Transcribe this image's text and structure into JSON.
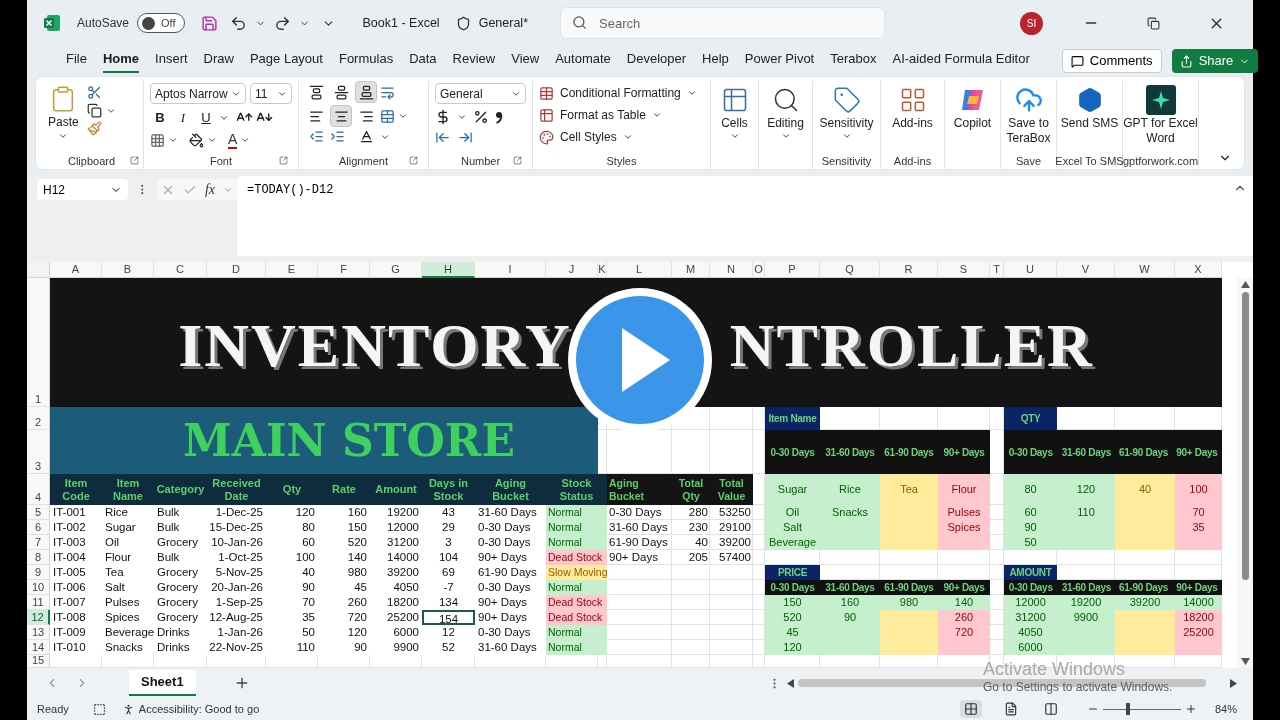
{
  "title_bar": {
    "autosave_label": "AutoSave",
    "autosave": {
      "on": false,
      "text": "Off"
    },
    "title": "Book1 - Excel",
    "sensitivity": "General*",
    "search_placeholder": "Search",
    "user_initials": "SI"
  },
  "menu_tabs": [
    {
      "label": "File",
      "selected": false
    },
    {
      "label": "Home",
      "selected": true
    },
    {
      "label": "Insert",
      "selected": false
    },
    {
      "label": "Draw",
      "selected": false
    },
    {
      "label": "Page Layout",
      "selected": false
    },
    {
      "label": "Formulas",
      "selected": false
    },
    {
      "label": "Data",
      "selected": false
    },
    {
      "label": "Review",
      "selected": false
    },
    {
      "label": "View",
      "selected": false
    },
    {
      "label": "Automate",
      "selected": false
    },
    {
      "label": "Developer",
      "selected": false
    },
    {
      "label": "Help",
      "selected": false
    },
    {
      "label": "Power Pivot",
      "selected": false
    },
    {
      "label": "Terabox",
      "selected": false
    },
    {
      "label": "AI-aided Formula Editor",
      "selected": false
    }
  ],
  "comments_button": "Comments",
  "share_button": "Share",
  "ribbon": {
    "clipboard": {
      "paste": "Paste",
      "label": "Clipboard"
    },
    "font": {
      "family": "Aptos Narrow",
      "size": "11",
      "bold": "B",
      "italic": "I",
      "underline": "U",
      "color_letter": "A",
      "label": "Font"
    },
    "alignment": {
      "vertical": [
        {
          "selected": false
        },
        {
          "selected": false
        },
        {
          "selected": true
        }
      ],
      "horizontal": [
        {
          "selected": false
        },
        {
          "selected": true
        },
        {
          "selected": false
        }
      ],
      "label": "Alignment"
    },
    "number": {
      "format": "General",
      "label": "Number"
    },
    "styles": {
      "items": [
        "Conditional Formatting",
        "Format as Table",
        "Cell Styles"
      ],
      "label": "Styles"
    },
    "large": [
      {
        "kind": "cells",
        "label": "Cells",
        "dropdown": true
      },
      {
        "kind": "editing",
        "label": "Editing",
        "dropdown": true
      },
      {
        "kind": "sensitivity",
        "label": "Sensitivity",
        "dropdown": true,
        "group": "Sensitivity"
      },
      {
        "kind": "addins",
        "label": "Add-ins",
        "dropdown": false,
        "group": "Add-ins"
      },
      {
        "kind": "copilot",
        "label": "Copilot",
        "dropdown": false
      },
      {
        "kind": "terabox",
        "label": "Save to TeraBox",
        "dropdown": false,
        "group": "Save"
      },
      {
        "kind": "sms",
        "label": "Send SMS",
        "dropdown": false,
        "group": "Excel To SMS"
      },
      {
        "kind": "gpt",
        "label": "GPT for Excel Word",
        "dropdown": false,
        "group": "gptforwork.com"
      }
    ]
  },
  "formula_bar": {
    "name_box": "H12",
    "fx": "fx",
    "formula": "=TODAY()-D12"
  },
  "sheet": {
    "columns": [
      {
        "label": "A",
        "selected": false
      },
      {
        "label": "B",
        "selected": false
      },
      {
        "label": "C",
        "selected": false
      },
      {
        "label": "D",
        "selected": false
      },
      {
        "label": "E",
        "selected": false
      },
      {
        "label": "F",
        "selected": false
      },
      {
        "label": "G",
        "selected": false
      },
      {
        "label": "H",
        "selected": true
      },
      {
        "label": "I",
        "selected": false
      },
      {
        "label": "J",
        "selected": false
      },
      {
        "label": "K",
        "selected": false
      },
      {
        "label": "L",
        "selected": false
      },
      {
        "label": "M",
        "selected": false
      },
      {
        "label": "N",
        "selected": false
      },
      {
        "label": "O",
        "selected": false
      },
      {
        "label": "P",
        "selected": false
      },
      {
        "label": "Q",
        "selected": false
      },
      {
        "label": "R",
        "selected": false
      },
      {
        "label": "S",
        "selected": false
      },
      {
        "label": "T",
        "selected": false
      },
      {
        "label": "U",
        "selected": false
      },
      {
        "label": "V",
        "selected": false
      },
      {
        "label": "W",
        "selected": false
      },
      {
        "label": "X",
        "selected": false
      }
    ],
    "rows": [
      {
        "label": "1",
        "selected": false
      },
      {
        "label": "2",
        "selected": false
      },
      {
        "label": "3",
        "selected": false
      },
      {
        "label": "4",
        "selected": false
      },
      {
        "label": "5",
        "selected": false
      },
      {
        "label": "6",
        "selected": false
      },
      {
        "label": "7",
        "selected": false
      },
      {
        "label": "8",
        "selected": false
      },
      {
        "label": "9",
        "selected": false
      },
      {
        "label": "10",
        "selected": false
      },
      {
        "label": "11",
        "selected": false
      },
      {
        "label": "12",
        "selected": true
      },
      {
        "label": "13",
        "selected": false
      },
      {
        "label": "14",
        "selected": false
      },
      {
        "label": "15",
        "selected": false
      }
    ],
    "banner_left": "INVENTORY",
    "banner_right": "NTROLLER",
    "store_title": "MAIN STORE",
    "headers": [
      "Item Code",
      "Item Name",
      "Category",
      "Received Date",
      "Qty",
      "Rate",
      "Amount",
      "Days in Stock",
      "Aging Bucket",
      "Stock Status"
    ],
    "items": [
      {
        "cells": [
          "IT-001",
          "Rice",
          "Bulk",
          "1-Dec-25",
          "120",
          "160",
          "19200",
          "43",
          "31-60 Days"
        ],
        "status": "Normal",
        "kind": "normal",
        "days_selected": false
      },
      {
        "cells": [
          "IT-002",
          "Sugar",
          "Bulk",
          "15-Dec-25",
          "80",
          "150",
          "12000",
          "29",
          "0-30 Days"
        ],
        "status": "Normal",
        "kind": "normal",
        "days_selected": false
      },
      {
        "cells": [
          "IT-003",
          "Oil",
          "Grocery",
          "10-Jan-26",
          "60",
          "520",
          "31200",
          "3",
          "0-30 Days"
        ],
        "status": "Normal",
        "kind": "normal",
        "days_selected": false
      },
      {
        "cells": [
          "IT-004",
          "Flour",
          "Bulk",
          "1-Oct-25",
          "100",
          "140",
          "14000",
          "104",
          "90+ Days"
        ],
        "status": "Dead Stock",
        "kind": "dead",
        "days_selected": false
      },
      {
        "cells": [
          "IT-005",
          "Tea",
          "Grocery",
          "5-Nov-25",
          "40",
          "980",
          "39200",
          "69",
          "61-90 Days"
        ],
        "status": "Slow Moving",
        "kind": "slow",
        "days_selected": false
      },
      {
        "cells": [
          "IT-006",
          "Salt",
          "Grocery",
          "20-Jan-26",
          "90",
          "45",
          "4050",
          "-7",
          "0-30 Days"
        ],
        "status": "Normal",
        "kind": "normal",
        "days_selected": false
      },
      {
        "cells": [
          "IT-007",
          "Pulses",
          "Grocery",
          "1-Sep-25",
          "70",
          "260",
          "18200",
          "134",
          "90+ Days"
        ],
        "status": "Dead Stock",
        "kind": "dead",
        "days_selected": false
      },
      {
        "cells": [
          "IT-008",
          "Spices",
          "Grocery",
          "12-Aug-25",
          "35",
          "720",
          "25200",
          "154",
          "90+ Days"
        ],
        "status": "Dead Stock",
        "kind": "dead",
        "days_selected": true
      },
      {
        "cells": [
          "IT-009",
          "Beverage",
          "Drinks",
          "1-Jan-26",
          "50",
          "120",
          "6000",
          "12",
          "0-30 Days"
        ],
        "status": "Normal",
        "kind": "normal",
        "days_selected": false
      },
      {
        "cells": [
          "IT-010",
          "Snacks",
          "Drinks",
          "22-Nov-25",
          "110",
          "90",
          "9900",
          "52",
          "31-60 Days"
        ],
        "status": "Normal",
        "kind": "normal",
        "days_selected": false
      }
    ],
    "summary": {
      "headers": [
        "Aging Bucket",
        "Total Qty",
        "Total Value"
      ],
      "rows": [
        [
          "0-30 Days",
          "280",
          "53250"
        ],
        [
          "31-60 Days",
          "230",
          "29100"
        ],
        [
          "61-90 Days",
          "40",
          "39200"
        ],
        [
          "90+ Days",
          "205",
          "57400"
        ]
      ]
    },
    "pivots": [
      {
        "label": "Item Name",
        "headers": [
          "0-30 Days",
          "31-60 Days",
          "61-90 Days",
          "90+ Days"
        ],
        "rows": [
          [
            {
              "text": "Sugar",
              "kind": "normal"
            },
            {
              "text": "Rice",
              "kind": "normal"
            },
            {
              "text": "Tea",
              "kind": "slow"
            },
            {
              "text": "Flour",
              "kind": "dead"
            }
          ],
          [
            {
              "text": "Oil",
              "kind": "normal"
            },
            {
              "text": "Snacks",
              "kind": "normal"
            },
            {
              "kind": "slow"
            },
            {
              "text": "Pulses",
              "kind": "dead"
            }
          ],
          [
            {
              "text": "Salt",
              "kind": "normal"
            },
            {
              "kind": "normal"
            },
            {
              "kind": "slow"
            },
            {
              "text": "Spices",
              "kind": "dead"
            }
          ],
          [
            {
              "text": "Beverage",
              "kind": "normal"
            },
            {
              "kind": "normal"
            },
            {
              "kind": "slow"
            },
            {
              "kind": "dead"
            }
          ]
        ]
      },
      {
        "label": "QTY",
        "headers": [
          "0-30 Days",
          "31-60 Days",
          "61-90 Days",
          "90+ Days"
        ],
        "rows": [
          [
            {
              "text": "80",
              "kind": "normal"
            },
            {
              "text": "120",
              "kind": "normal"
            },
            {
              "text": "40",
              "kind": "slow"
            },
            {
              "text": "100",
              "kind": "dead"
            }
          ],
          [
            {
              "text": "60",
              "kind": "normal"
            },
            {
              "text": "110",
              "kind": "normal"
            },
            {
              "kind": "slow"
            },
            {
              "text": "70",
              "kind": "dead"
            }
          ],
          [
            {
              "text": "90",
              "kind": "normal"
            },
            {
              "kind": "normal"
            },
            {
              "kind": "slow"
            },
            {
              "text": "35",
              "kind": "dead"
            }
          ],
          [
            {
              "text": "50",
              "kind": "normal"
            },
            {
              "kind": "normal"
            },
            {
              "kind": "slow"
            },
            {
              "kind": "dead"
            }
          ]
        ]
      },
      {
        "label": "PRICE",
        "headers": [
          "0-30 Days",
          "31-60 Days",
          "61-90 Days",
          "90+ Days"
        ],
        "rows": [
          [
            {
              "text": "150",
              "kind": "normal"
            },
            {
              "text": "160",
              "kind": "normal"
            },
            {
              "text": "980",
              "kind": "normal"
            },
            {
              "text": "140",
              "kind": "normal"
            }
          ],
          [
            {
              "text": "520",
              "kind": "normal"
            },
            {
              "text": "90",
              "kind": "normal"
            },
            {
              "kind": "slow"
            },
            {
              "text": "260",
              "kind": "dead"
            }
          ],
          [
            {
              "text": "45",
              "kind": "normal"
            },
            {
              "kind": "normal"
            },
            {
              "kind": "slow"
            },
            {
              "text": "720",
              "kind": "dead"
            }
          ],
          [
            {
              "text": "120",
              "kind": "normal"
            },
            {
              "kind": "normal"
            },
            {
              "kind": "slow"
            },
            {
              "kind": "dead"
            }
          ]
        ]
      },
      {
        "label": "AMOUNT",
        "headers": [
          "0-30 Days",
          "31-60 Days",
          "61-90 Days",
          "90+ Days"
        ],
        "rows": [
          [
            {
              "text": "12000",
              "kind": "normal"
            },
            {
              "text": "19200",
              "kind": "normal"
            },
            {
              "text": "39200",
              "kind": "normal"
            },
            {
              "text": "14000",
              "kind": "normal"
            }
          ],
          [
            {
              "text": "31200",
              "kind": "normal"
            },
            {
              "text": "9900",
              "kind": "normal"
            },
            {
              "kind": "slow"
            },
            {
              "text": "18200",
              "kind": "dead"
            }
          ],
          [
            {
              "text": "4050",
              "kind": "normal"
            },
            {
              "kind": "normal"
            },
            {
              "kind": "slow"
            },
            {
              "text": "25200",
              "kind": "dead"
            }
          ],
          [
            {
              "text": "6000",
              "kind": "normal"
            },
            {
              "kind": "normal"
            },
            {
              "kind": "slow"
            },
            {
              "kind": "dead"
            }
          ]
        ]
      }
    ]
  },
  "sheet_tabs": [
    {
      "label": "Sheet1",
      "selected": true
    }
  ],
  "status_bar": {
    "mode": "Ready",
    "accessibility": "Accessibility: Good to go",
    "views": [
      {
        "kind": "normal",
        "selected": true
      },
      {
        "kind": "page_layout",
        "selected": false
      },
      {
        "kind": "page_break",
        "selected": false
      }
    ],
    "zoom": {
      "level": 0.3,
      "text": "84%"
    }
  },
  "os_notice": {
    "title": "Activate Windows",
    "text": "Go to Settings to activate Windows."
  }
}
